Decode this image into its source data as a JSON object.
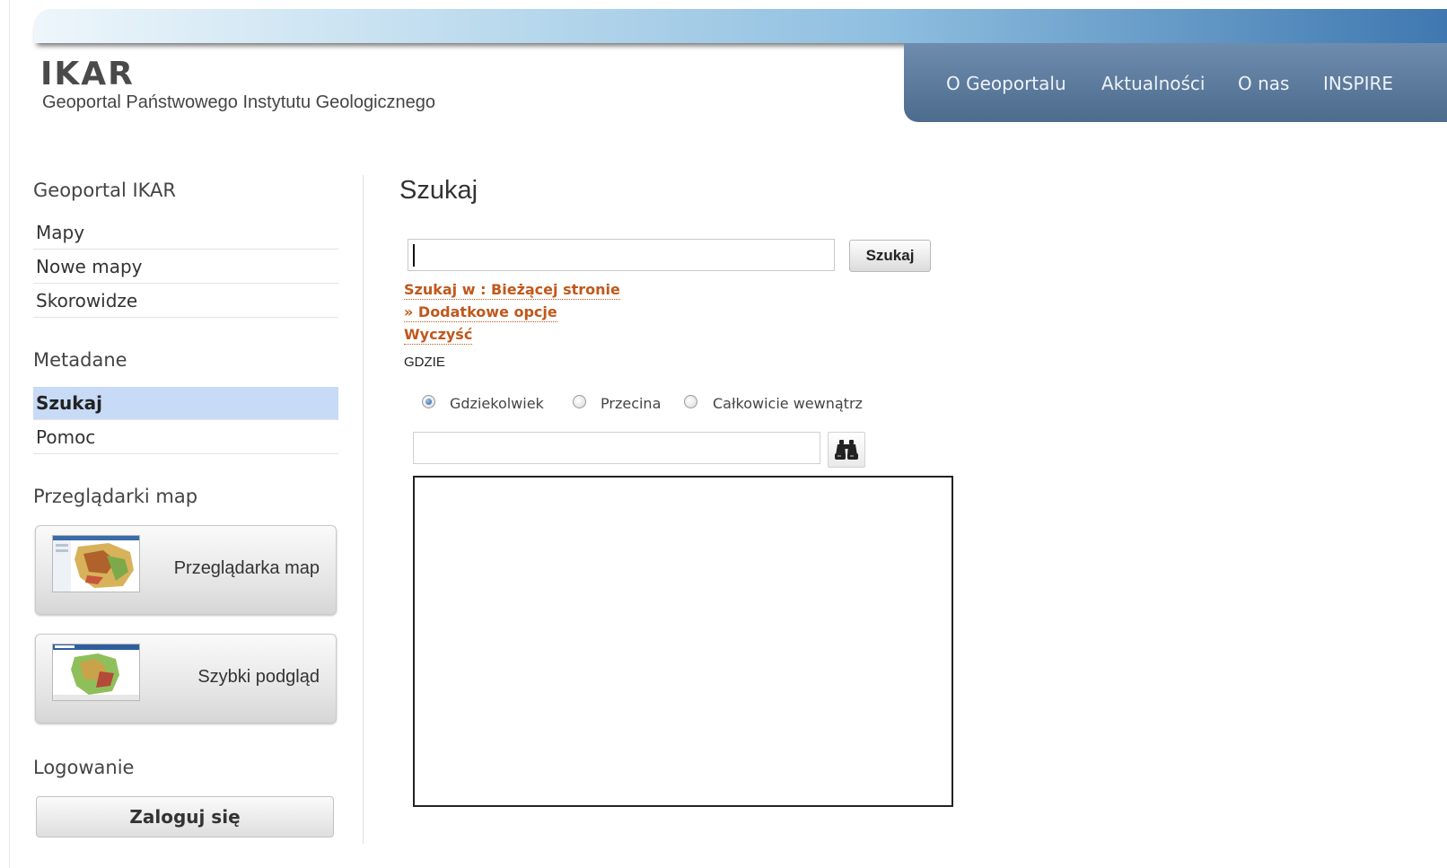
{
  "header": {
    "logo": "IKAR",
    "subtitle": "Geoportal Państwowego Instytutu Geologicznego",
    "nav": [
      "O Geoportalu",
      "Aktualności",
      "O nas",
      "INSPIRE"
    ]
  },
  "sidebar": {
    "geoportal_title": "Geoportal IKAR",
    "geoportal_items": [
      "Mapy",
      "Nowe mapy",
      "Skorowidze"
    ],
    "metadane_title": "Metadane",
    "metadane_items": [
      "Szukaj",
      "Pomoc"
    ],
    "active_item": "Szukaj",
    "viewers_title": "Przeglądarki map",
    "viewers": [
      "Przeglądarka map",
      "Szybki podgląd"
    ],
    "login_title": "Logowanie",
    "login_button": "Zaloguj się"
  },
  "main": {
    "title": "Szukaj",
    "search_value": "",
    "search_button": "Szukaj",
    "links": [
      "Szukaj w : Bieżącej stronie",
      "» Dodatkowe opcje",
      "Wyczyść"
    ],
    "where_label": "GDZIE",
    "where_options": [
      "Gdziekolwiek",
      "Przecina",
      "Całkowicie wewnątrz"
    ],
    "where_selected": "Gdziekolwiek",
    "place_value": ""
  },
  "colors": {
    "nav_bg": "#5a7899",
    "link_orange": "#c0581c",
    "active_bg": "#c7daf6"
  },
  "icons": {
    "place_search": "binoculars-icon"
  }
}
